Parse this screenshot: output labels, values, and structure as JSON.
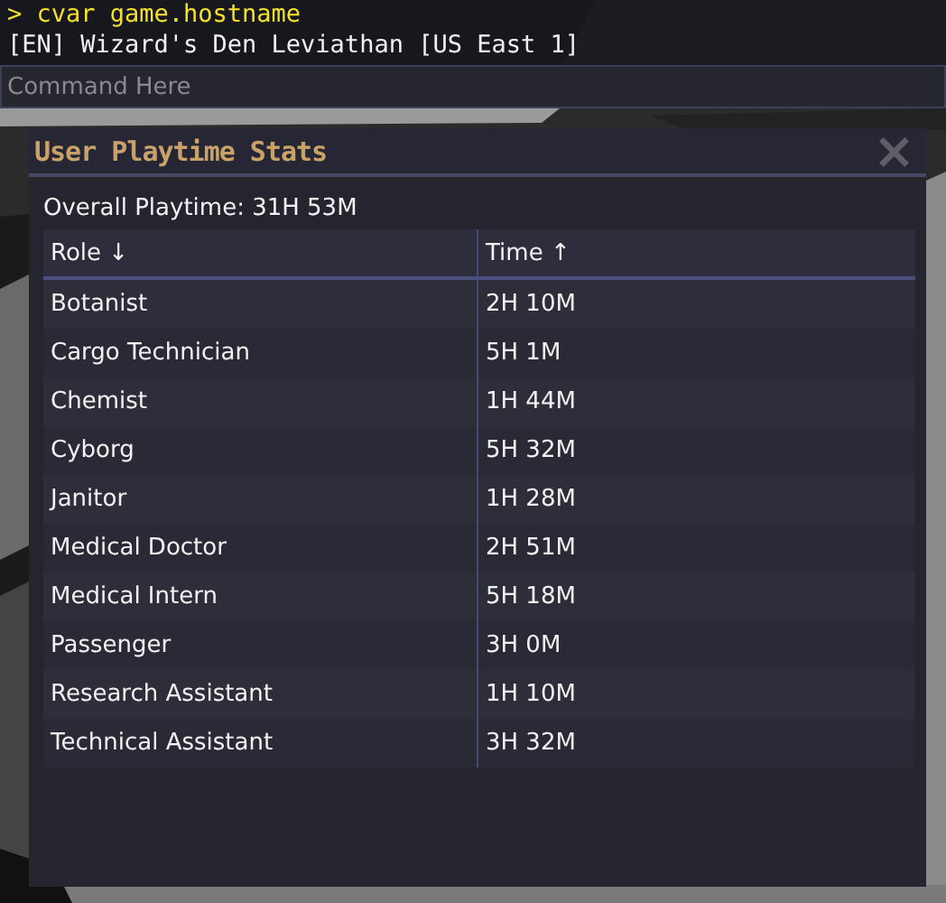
{
  "console": {
    "lines": [
      {
        "kind": "command",
        "text": "> cvar game.hostname"
      },
      {
        "kind": "output",
        "text": "[EN] Wizard's Den Leviathan [US East 1]"
      }
    ],
    "input": {
      "placeholder": "Command Here"
    }
  },
  "window": {
    "title": "User Playtime Stats",
    "close": "×",
    "summary": "Overall Playtime: 31H 53M",
    "table": {
      "columns": [
        "Role ↓",
        "Time ↑"
      ],
      "rows": [
        [
          "Botanist",
          "2H 10M"
        ],
        [
          "Cargo Technician",
          "5H 1M"
        ],
        [
          "Chemist",
          "1H 44M"
        ],
        [
          "Cyborg",
          "5H 32M"
        ],
        [
          "Janitor",
          "1H 28M"
        ],
        [
          "Medical Doctor",
          "2H 51M"
        ],
        [
          "Medical Intern",
          "5H 18M"
        ],
        [
          "Passenger",
          "3H 0M"
        ],
        [
          "Research Assistant",
          "1H 10M"
        ],
        [
          "Technical Assistant",
          "3H 32M"
        ]
      ]
    }
  }
}
